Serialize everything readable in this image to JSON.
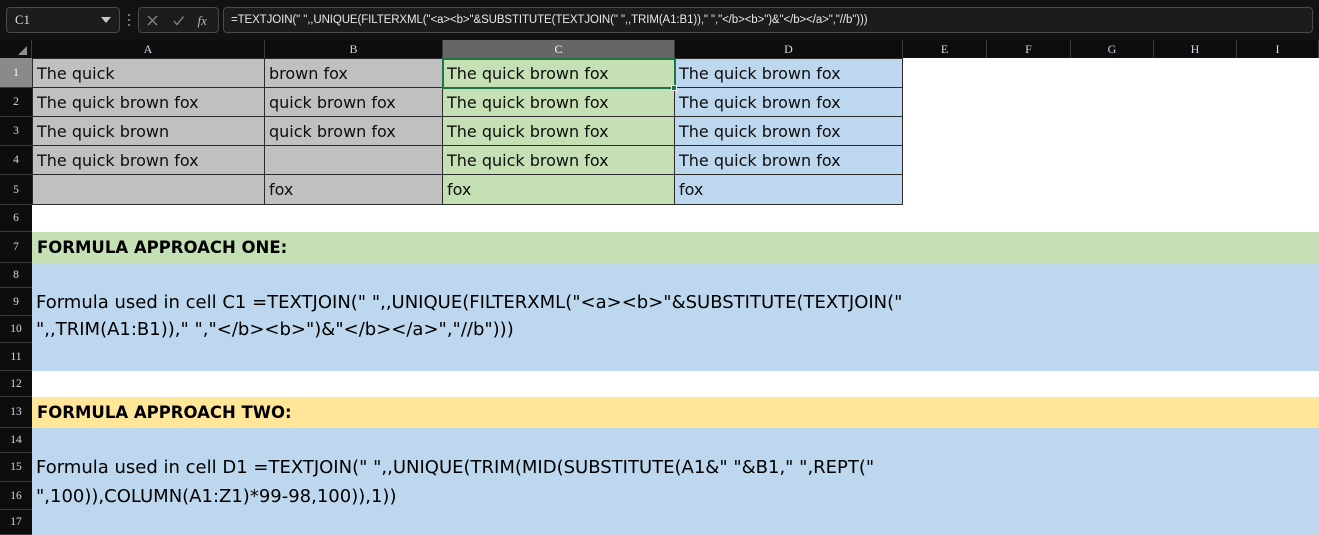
{
  "formula_bar": {
    "name_box_value": "C1",
    "formula": "=TEXTJOIN(\" \",,UNIQUE(FILTERXML(\"<a><b>\"&SUBSTITUTE(TEXTJOIN(\" \",,TRIM(A1:B1)),\" \",\"</b><b>\")&\"</b></a>\",\"//b\")))",
    "icons": {
      "cancel": "cancel-icon",
      "enter": "enter-icon",
      "function": "fx-icon",
      "dropdown": "chevron-down-icon"
    }
  },
  "grid": {
    "column_headers": [
      "A",
      "B",
      "C",
      "D",
      "E",
      "F",
      "G",
      "H",
      "I"
    ],
    "selected_column": "C",
    "row_headers": [
      "1",
      "2",
      "3",
      "4",
      "5",
      "6",
      "7",
      "8",
      "9",
      "10",
      "11",
      "12",
      "13",
      "14",
      "15",
      "16",
      "17"
    ],
    "selected_row": "1",
    "active_cell": "C1",
    "data": {
      "A": [
        "The quick",
        "The quick brown fox",
        "The quick brown",
        "The quick brown fox",
        ""
      ],
      "B": [
        "brown fox",
        "quick brown fox",
        "quick brown fox",
        "",
        "fox"
      ],
      "C": [
        "The quick brown fox",
        "The quick brown fox",
        "The quick brown fox",
        "The quick brown fox",
        "fox"
      ],
      "D": [
        "The quick brown fox",
        "The quick brown fox",
        "The quick brown fox",
        "The quick brown fox",
        "fox"
      ]
    }
  },
  "notes": {
    "approach_one_heading": "FORMULA APPROACH ONE:",
    "approach_one_line1": "Formula used in cell C1 =TEXTJOIN(\" \",,UNIQUE(FILTERXML(\"<a><b>\"&SUBSTITUTE(TEXTJOIN(\"",
    "approach_one_line2": "\",,TRIM(A1:B1)),\" \",\"</b><b>\")&\"</b></a>\",\"//b\")))",
    "approach_two_heading": "FORMULA APPROACH TWO:",
    "approach_two_line1": "Formula used in cell D1 =TEXTJOIN(\" \",,UNIQUE(TRIM(MID(SUBSTITUTE(A1&\" \"&B1,\" \",REPT(\"",
    "approach_two_line2": "\",100)),COLUMN(A1:Z1)*99-98,100)),1))"
  },
  "colors": {
    "green": "#c5e0b4",
    "blue": "#bdd7ee",
    "yellow": "#ffe699",
    "grey": "#c0c0c0",
    "accent": "#217346"
  }
}
